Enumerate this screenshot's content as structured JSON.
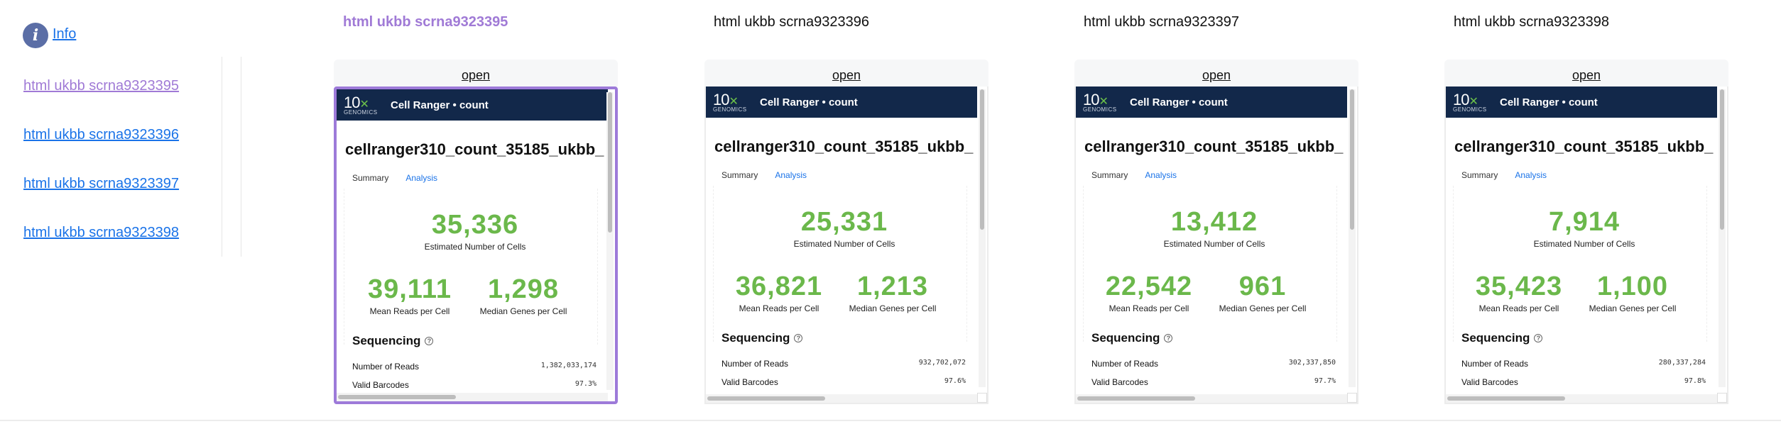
{
  "sidebar": {
    "info_label": "Info",
    "links": [
      {
        "label": "html ukbb scrna9323395"
      },
      {
        "label": "html ukbb scrna9323396"
      },
      {
        "label": "html ukbb scrna9323397"
      },
      {
        "label": "html ukbb scrna9323398"
      }
    ]
  },
  "panels": [
    {
      "title": "html ukbb scrna9323395",
      "open_label": "open",
      "report": {
        "logo_main": "10",
        "logo_sub": "GENOMICS",
        "header": "Cell Ranger • count",
        "sample": "cellranger310_count_35185_ukbb_",
        "tabs": [
          "Summary",
          "Analysis"
        ],
        "cells": "35,336",
        "cells_label": "Estimated Number of Cells",
        "reads": "39,111",
        "reads_label": "Mean Reads per Cell",
        "genes": "1,298",
        "genes_label": "Median Genes per Cell",
        "seq_title": "Sequencing",
        "num_reads_label": "Number of Reads",
        "num_reads": "1,382,033,174",
        "valid_label": "Valid Barcodes",
        "valid": "97.3%"
      }
    },
    {
      "title": "html ukbb scrna9323396",
      "open_label": "open",
      "report": {
        "logo_main": "10",
        "logo_sub": "GENOMICS",
        "header": "Cell Ranger • count",
        "sample": "cellranger310_count_35185_ukbb_",
        "tabs": [
          "Summary",
          "Analysis"
        ],
        "cells": "25,331",
        "cells_label": "Estimated Number of Cells",
        "reads": "36,821",
        "reads_label": "Mean Reads per Cell",
        "genes": "1,213",
        "genes_label": "Median Genes per Cell",
        "seq_title": "Sequencing",
        "num_reads_label": "Number of Reads",
        "num_reads": "932,702,072",
        "valid_label": "Valid Barcodes",
        "valid": "97.6%"
      }
    },
    {
      "title": "html ukbb scrna9323397",
      "open_label": "open",
      "report": {
        "logo_main": "10",
        "logo_sub": "GENOMICS",
        "header": "Cell Ranger • count",
        "sample": "cellranger310_count_35185_ukbb_",
        "tabs": [
          "Summary",
          "Analysis"
        ],
        "cells": "13,412",
        "cells_label": "Estimated Number of Cells",
        "reads": "22,542",
        "reads_label": "Mean Reads per Cell",
        "genes": "961",
        "genes_label": "Median Genes per Cell",
        "seq_title": "Sequencing",
        "num_reads_label": "Number of Reads",
        "num_reads": "302,337,850",
        "valid_label": "Valid Barcodes",
        "valid": "97.7%"
      }
    },
    {
      "title": "html ukbb scrna9323398",
      "open_label": "open",
      "report": {
        "logo_main": "10",
        "logo_sub": "GENOMICS",
        "header": "Cell Ranger • count",
        "sample": "cellranger310_count_35185_ukbb_",
        "tabs": [
          "Summary",
          "Analysis"
        ],
        "cells": "7,914",
        "cells_label": "Estimated Number of Cells",
        "reads": "35,423",
        "reads_label": "Mean Reads per Cell",
        "genes": "1,100",
        "genes_label": "Median Genes per Cell",
        "seq_title": "Sequencing",
        "num_reads_label": "Number of Reads",
        "num_reads": "280,337,284",
        "valid_label": "Valid Barcodes",
        "valid": "97.8%"
      }
    }
  ],
  "colors": {
    "link": "#1a73e8",
    "visited": "#a07ad6",
    "metric_green": "#6bb84b",
    "header_navy": "#12284a",
    "selected_border": "#9d7ad9"
  }
}
